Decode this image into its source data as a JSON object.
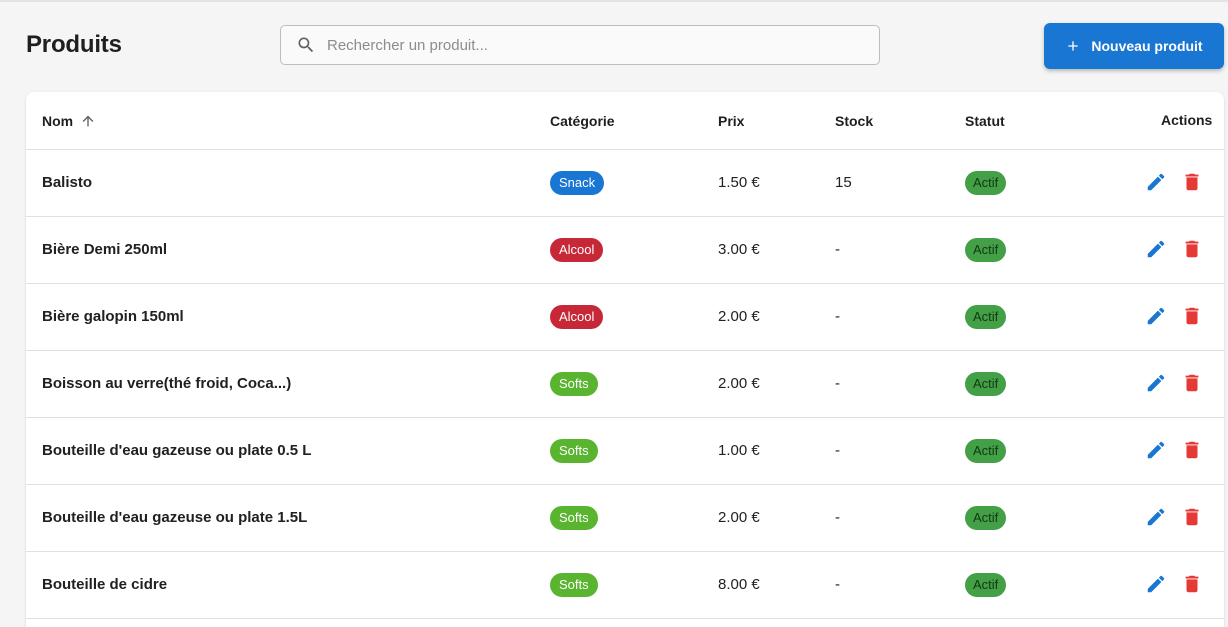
{
  "header": {
    "title": "Produits",
    "search_placeholder": "Rechercher un produit...",
    "new_button_label": "Nouveau produit"
  },
  "table": {
    "columns": {
      "name": "Nom",
      "category": "Catégorie",
      "price": "Prix",
      "stock": "Stock",
      "status": "Statut",
      "actions": "Actions"
    },
    "sort": {
      "column": "Nom",
      "direction": "ascending"
    },
    "rows": [
      {
        "name": "Balisto",
        "category": "Snack",
        "category_color": "#1976d2",
        "price": "1.50 €",
        "stock": "15",
        "status": "Actif"
      },
      {
        "name": "Bière Demi 250ml",
        "category": "Alcool",
        "category_color": "#c62838",
        "price": "3.00 €",
        "stock": "-",
        "status": "Actif"
      },
      {
        "name": "Bière galopin 150ml",
        "category": "Alcool",
        "category_color": "#c62838",
        "price": "2.00 €",
        "stock": "-",
        "status": "Actif"
      },
      {
        "name": "Boisson au verre(thé froid, Coca...)",
        "category": "Softs",
        "category_color": "#59b42f",
        "price": "2.00 €",
        "stock": "-",
        "status": "Actif"
      },
      {
        "name": "Bouteille d'eau gazeuse ou plate 0.5 L",
        "category": "Softs",
        "category_color": "#59b42f",
        "price": "1.00 €",
        "stock": "-",
        "status": "Actif"
      },
      {
        "name": "Bouteille d'eau gazeuse ou plate 1.5L",
        "category": "Softs",
        "category_color": "#59b42f",
        "price": "2.00 €",
        "stock": "-",
        "status": "Actif"
      },
      {
        "name": "Bouteille de cidre",
        "category": "Softs",
        "category_color": "#59b42f",
        "price": "8.00 €",
        "stock": "-",
        "status": "Actif"
      }
    ]
  },
  "icons": {
    "search": "search-icon",
    "add": "plus-icon",
    "sort": "arrow-up-icon",
    "edit": "pencil-icon",
    "delete": "trash-icon"
  },
  "colors": {
    "primary": "#1976d2",
    "edit_icon": "#1976d2",
    "delete_icon": "#e53935",
    "status_active": "#43a047"
  }
}
